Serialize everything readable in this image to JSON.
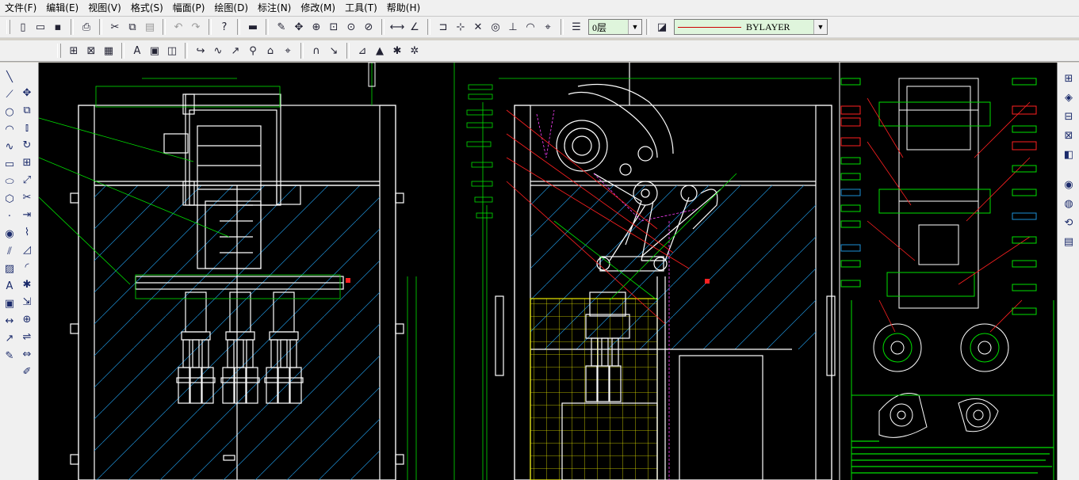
{
  "menu": [
    "文件(F)",
    "编辑(E)",
    "视图(V)",
    "格式(S)",
    "幅面(P)",
    "绘图(D)",
    "标注(N)",
    "修改(M)",
    "工具(T)",
    "帮助(H)"
  ],
  "layer_combo": {
    "value": "0层"
  },
  "linetype_combo": {
    "value": "BYLAYER"
  },
  "colors": {
    "canvas": "#000000",
    "outline": "#ffffff",
    "dim": "#00ff00",
    "leader": "#ff2020",
    "hatch": "#00bfff",
    "grid": "#ffff00",
    "construct": "#ff00ff"
  },
  "icons": {
    "toolbar1": [
      "new-file-icon",
      "open-file-icon",
      "save-icon",
      "print-icon",
      "cut-icon",
      "copy-icon",
      "paste-icon",
      "undo-icon",
      "redo-icon",
      "help-icon",
      "ruler-icon",
      "pencil-icon",
      "pan-icon",
      "zoom-realtime-icon",
      "zoom-window-icon",
      "zoom-all-icon",
      "zoom-previous-icon",
      "distance-icon",
      "angle-icon",
      "snap-endpoint-icon",
      "snap-midpoint-icon",
      "snap-intersection-icon",
      "snap-center-icon",
      "snap-perpendicular-icon",
      "snap-tangent-icon",
      "snap-nearest-icon",
      "layer-manager-icon",
      "linetype-icon"
    ],
    "toolbar2": [
      "zoom-extents-icon",
      "zoom-scale-icon",
      "properties-icon",
      "text-style-icon",
      "dim-style-icon",
      "block-insert-icon",
      "rotate-curve-icon",
      "polar-icon",
      "spline-icon",
      "ortho-icon",
      "grid-icon",
      "magnet-snap-icon",
      "osnap-icon",
      "measure-icon",
      "ucs-icon",
      "region-icon"
    ],
    "left": [
      "line-icon",
      "construction-line-icon",
      "circle-icon",
      "arc-icon",
      "spline-icon",
      "rectangle-icon",
      "ellipse-icon",
      "polygon-icon",
      "point-icon",
      "donut-icon",
      "offset-icon",
      "hatch-icon",
      "text-icon",
      "block-icon",
      "dimension-icon",
      "leader-icon",
      "edit-icon",
      "move-icon",
      "copy-icon",
      "mirror-icon",
      "rotate-icon",
      "array-icon",
      "scale-icon",
      "trim-icon",
      "extend-icon",
      "break-icon",
      "chamfer-icon",
      "fillet-icon",
      "explode-icon",
      "stretch-icon",
      "join-icon",
      "align-icon",
      "lengthen-icon",
      "match-properties-icon"
    ],
    "right": [
      "view-3d-icon",
      "view-iso-icon",
      "view-front-icon",
      "view-side-icon",
      "view-top-icon",
      "render-icon",
      "shade-icon",
      "orbit-icon",
      "layout-icon"
    ]
  }
}
